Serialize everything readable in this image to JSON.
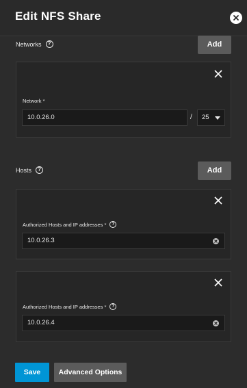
{
  "dialog": {
    "title": "Edit NFS Share"
  },
  "networks": {
    "label": "Networks",
    "add_label": "Add",
    "items": [
      {
        "field_label": "Network *",
        "value": "10.0.26.0",
        "separator": "/",
        "mask": "25"
      }
    ]
  },
  "hosts": {
    "label": "Hosts",
    "add_label": "Add",
    "items": [
      {
        "field_label": "Authorized Hosts and IP addresses *",
        "value": "10.0.26.3"
      },
      {
        "field_label": "Authorized Hosts and IP addresses *",
        "value": "10.0.26.4"
      }
    ]
  },
  "footer": {
    "save_label": "Save",
    "advanced_label": "Advanced Options"
  },
  "colors": {
    "primary": "#0095d5",
    "secondary_button": "#5b5b5b",
    "background": "#2c2c2c",
    "card": "#262626",
    "input": "#1a1a1a"
  },
  "help_glyph": "?"
}
